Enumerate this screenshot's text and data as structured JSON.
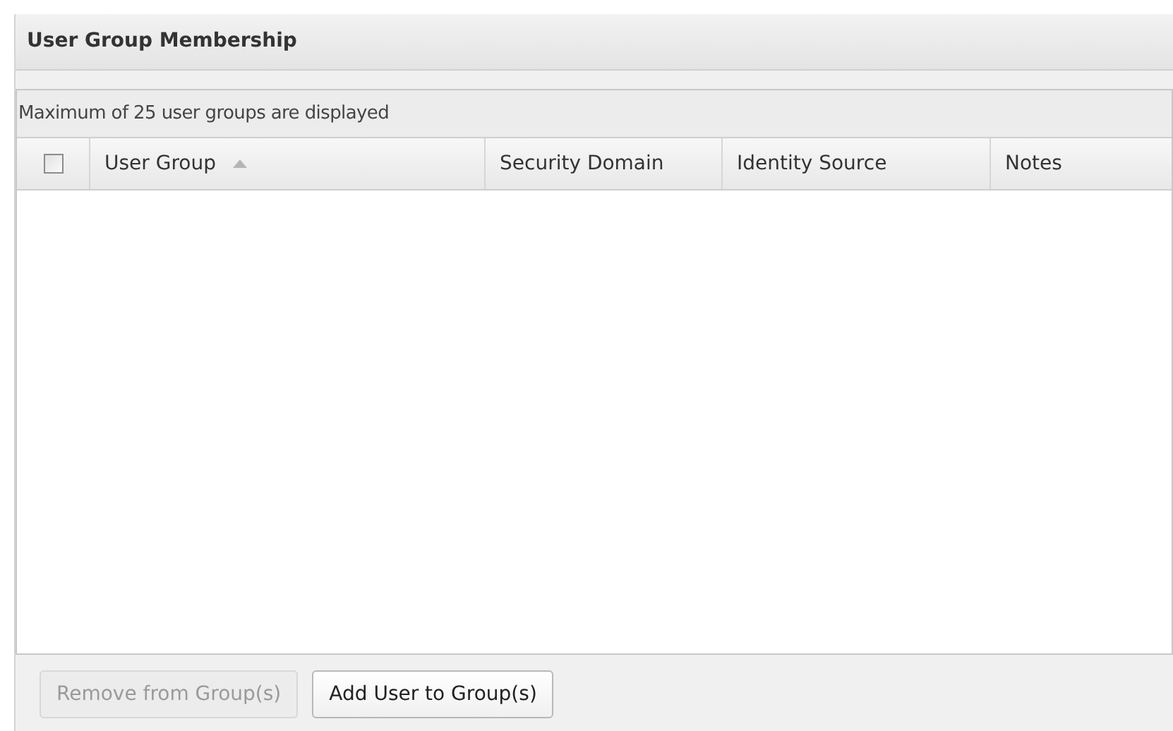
{
  "panel": {
    "title": "User Group Membership"
  },
  "grid": {
    "caption": "Maximum of 25 user groups are displayed",
    "select_all": {
      "checked": false
    },
    "columns": [
      {
        "label": "User Group",
        "sorted_ascending": true
      },
      {
        "label": "Security Domain"
      },
      {
        "label": "Identity Source"
      },
      {
        "label": "Notes"
      }
    ]
  },
  "buttons": [
    {
      "label": "Remove from Group(s)",
      "disabled": true
    },
    {
      "label": "Add User to Group(s)",
      "disabled": false
    }
  ]
}
